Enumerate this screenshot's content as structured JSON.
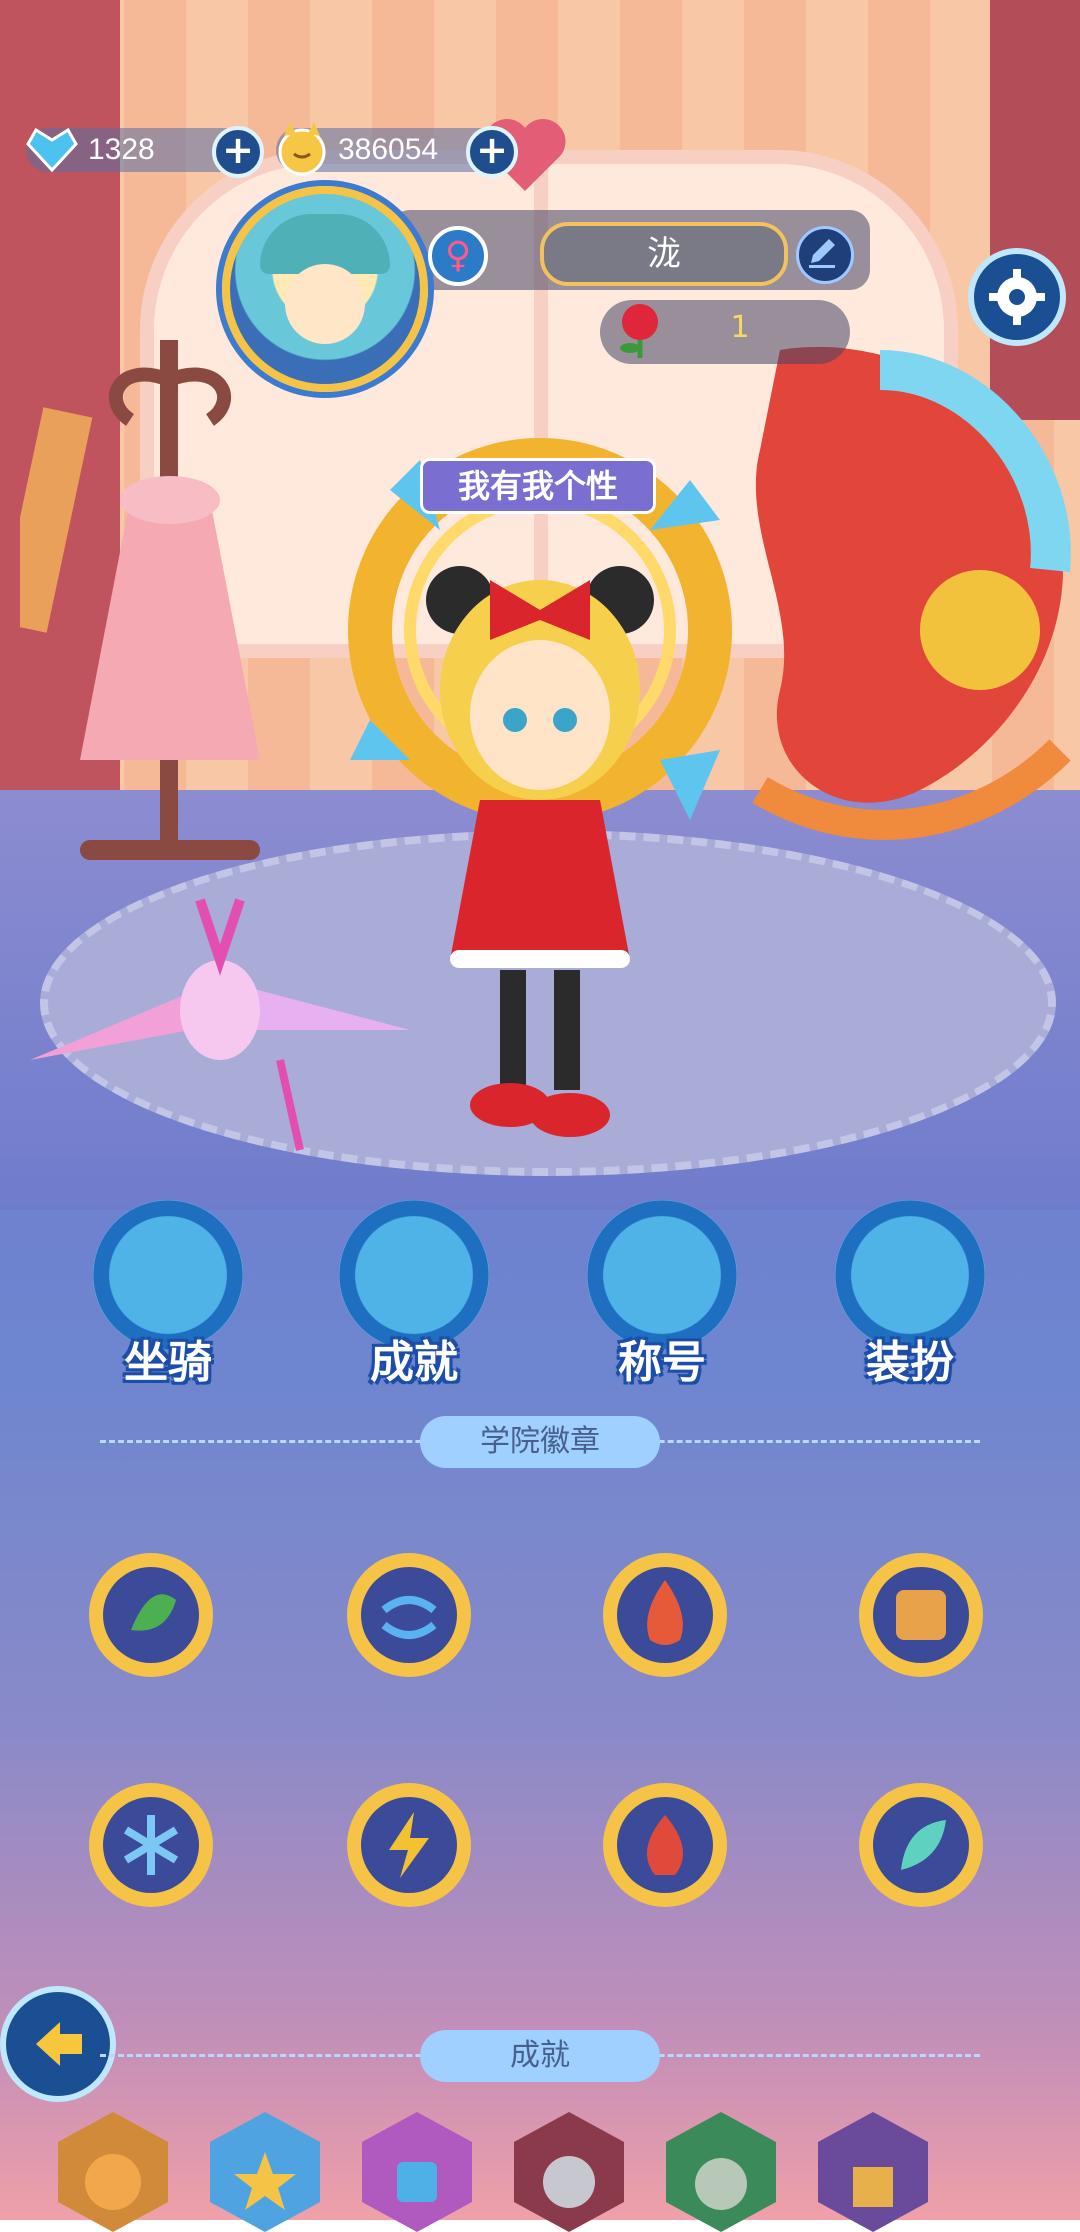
{
  "currency": {
    "gems": "1328",
    "coins": "386054"
  },
  "profile": {
    "name": "泷",
    "gender_symbol": "♀",
    "roses": "1"
  },
  "banner": "我有我个性",
  "functions": [
    {
      "label": "坐骑",
      "icon": "duck-icon"
    },
    {
      "label": "成就",
      "icon": "medal-icon"
    },
    {
      "label": "称号",
      "icon": "star-shield-icon"
    },
    {
      "label": "装扮",
      "icon": "fox-sweater-icon"
    }
  ],
  "sections": {
    "badges_title": "学院徽章",
    "achievements_title": "成就"
  },
  "badges": [
    {
      "name": "leaf-badge-icon",
      "color": "#4caf50"
    },
    {
      "name": "wind-badge-icon",
      "color": "#5ab3f0"
    },
    {
      "name": "fire-badge-icon",
      "color": "#e65a3a"
    },
    {
      "name": "earth-badge-icon",
      "color": "#e8a24a"
    },
    {
      "name": "ice-badge-icon",
      "color": "#7cc8f5"
    },
    {
      "name": "thunder-badge-icon",
      "color": "#f2c230"
    },
    {
      "name": "flame-badge-icon",
      "color": "#e04a3a"
    },
    {
      "name": "wing-badge-icon",
      "color": "#5fd1c0"
    }
  ],
  "achievement_icons": [
    "fox-achievement-icon",
    "star-achievement-icon",
    "dice-achievement-icon",
    "robot-achievement-icon",
    "bunny-achievement-icon",
    "castle-achievement-icon"
  ],
  "colors": {
    "accent_blue": "#1f4d8e",
    "gold": "#f5c446"
  }
}
